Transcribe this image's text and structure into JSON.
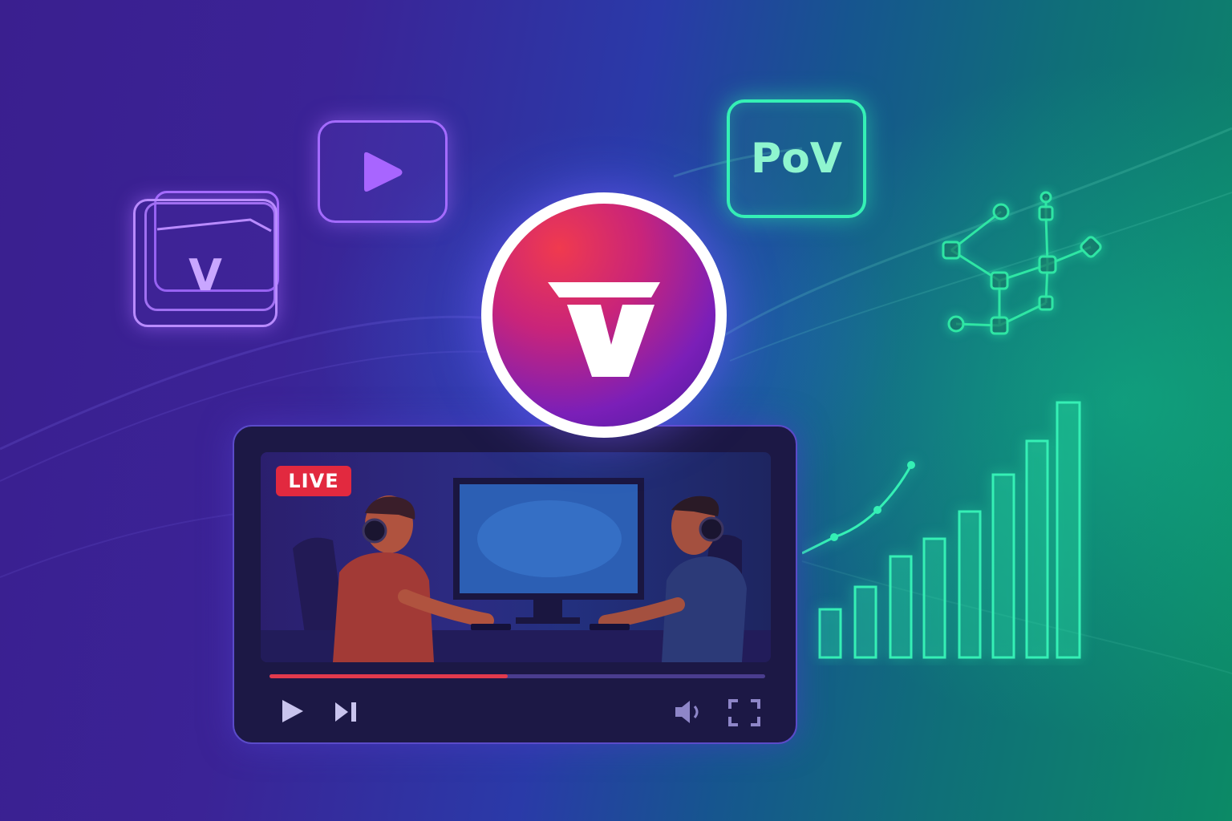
{
  "wallet": {
    "letter": "V"
  },
  "pov": {
    "label": "PoV"
  },
  "player": {
    "live_label": "LIVE",
    "progress": 0.48
  },
  "icons": [
    "wallet-icon",
    "play-icon",
    "network-graph-icon",
    "bar-chart-icon",
    "volume-icon",
    "fullscreen-icon",
    "next-icon"
  ],
  "colors": {
    "accent_purple": "#a46bff",
    "accent_green": "#35f0b5",
    "live_red": "#e2293f"
  }
}
